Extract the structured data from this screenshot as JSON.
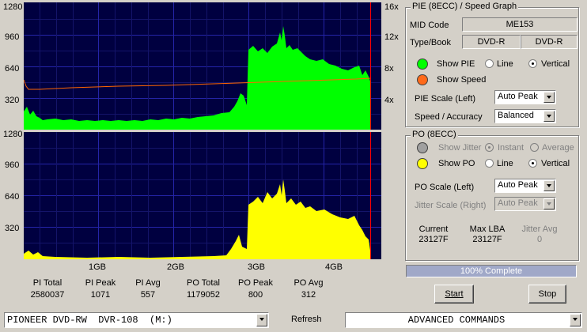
{
  "colors": {
    "pie": "#00ff00",
    "po": "#ffff00",
    "speed": "#ff6600",
    "plot_bg": "#000040",
    "grid": "#2020a0",
    "progress": "#a0a8c8"
  },
  "graph_top": {
    "left_axis": [
      "1280",
      "960",
      "640",
      "320"
    ],
    "right_axis": [
      "16x",
      "12x",
      "8x",
      "4x"
    ]
  },
  "graph_bottom": {
    "left_axis": [
      "1280",
      "960",
      "640",
      "320"
    ],
    "x_axis": [
      "1GB",
      "2GB",
      "3GB",
      "4GB"
    ]
  },
  "stats": [
    {
      "label": "PI Total",
      "value": "2580037"
    },
    {
      "label": "PI Peak",
      "value": "1071"
    },
    {
      "label": "PI Avg",
      "value": "557"
    },
    {
      "label": "PO Total",
      "value": "1179052"
    },
    {
      "label": "PO Peak",
      "value": "800"
    },
    {
      "label": "PO Avg",
      "value": "312"
    }
  ],
  "pie_panel": {
    "title": "PIE (8ECC) / Speed Graph",
    "mid_label": "MID Code",
    "mid_value": "ME153",
    "typebook_label": "Type/Book",
    "type_value": "DVD-R",
    "book_value": "DVD-R",
    "show_pie": "Show PIE",
    "show_speed": "Show Speed",
    "line": "Line",
    "vertical": "Vertical",
    "scale_label": "PIE Scale (Left)",
    "scale_value": "Auto Peak",
    "speed_label": "Speed / Accuracy",
    "speed_value": "Balanced"
  },
  "po_panel": {
    "title": "PO (8ECC)",
    "show_jitter": "Show Jitter",
    "instant": "Instant",
    "average": "Average",
    "show_po": "Show PO",
    "line": "Line",
    "vertical": "Vertical",
    "scale_label": "PO Scale (Left)",
    "scale_value": "Auto Peak",
    "jitter_scale_label": "Jitter Scale (Right)",
    "jitter_scale_value": "Auto Peak",
    "current_label": "Current",
    "current_value": "23127F",
    "maxlba_label": "Max LBA",
    "maxlba_value": "23127F",
    "jitter_avg_label": "Jitter Avg",
    "jitter_avg_value": "0"
  },
  "progress": {
    "text": "100% Complete",
    "fraction": 1.0
  },
  "buttons": {
    "start": "Start",
    "stop": "Stop",
    "refresh": "Refresh"
  },
  "drive": {
    "value": "PIONEER DVD-RW  DVR-108  (M:)"
  },
  "commands": {
    "value": "ADVANCED COMMANDS"
  }
}
